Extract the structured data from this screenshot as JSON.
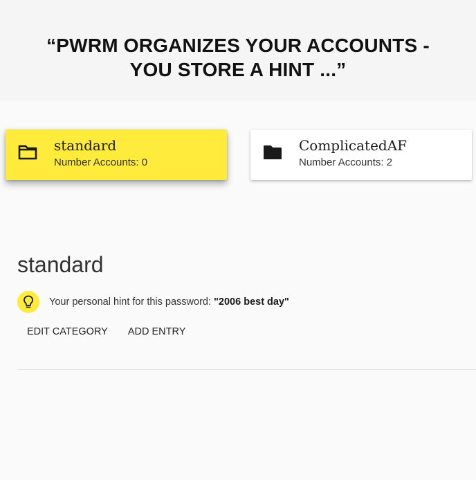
{
  "headline": {
    "line1": "“PWRM ORGANIZES YOUR ACCOUNTS -",
    "line2": "YOU STORE A HINT ...”"
  },
  "categories": [
    {
      "name": "standard",
      "count_text": "Number Accounts: 0",
      "selected": true,
      "icon": "folder-outline-icon"
    },
    {
      "name": "ComplicatedAF",
      "count_text": "Number Accounts: 2",
      "selected": false,
      "icon": "folder-filled-icon"
    }
  ],
  "detail": {
    "title": "standard",
    "hint_prefix": "Your personal hint for this password: ",
    "hint_value": "\"2006 best day\"",
    "hint_icon": "lightbulb-icon"
  },
  "actions": {
    "edit_label": "EDIT CATEGORY",
    "add_label": "ADD ENTRY"
  },
  "colors": {
    "accent": "#ffeb3b",
    "background": "#fafafa",
    "card": "#ffffff"
  }
}
